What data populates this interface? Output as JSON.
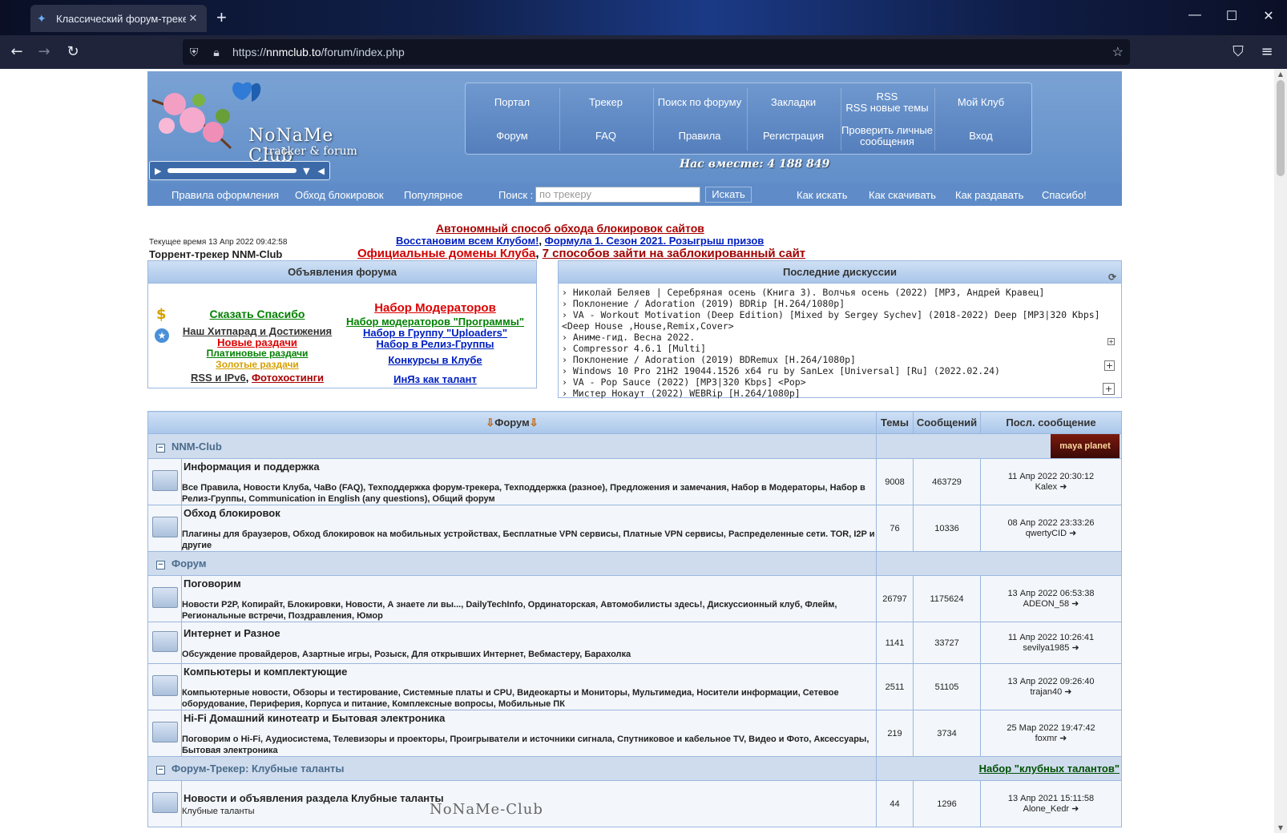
{
  "browser": {
    "tab_title": "Классический форум-трекер",
    "url_host": "nnmclub.to",
    "url_path": "/forum/index.php",
    "url_scheme": "https://"
  },
  "header": {
    "logo_name": "NoNaMe Club",
    "logo_sub": "tracker & forum",
    "menu": [
      [
        "Портал",
        "Трекер",
        "Поиск по форуму",
        "Закладки",
        "RSS\nRSS новые темы",
        "Мой Клуб"
      ],
      [
        "Форум",
        "FAQ",
        "Правила",
        "Регистрация",
        "Проверить личные сообщения",
        "Вход"
      ]
    ],
    "together": "Нас вместе: 4 188 849"
  },
  "subnav": {
    "left": [
      "Правила оформления",
      "Обход блокировок",
      "Популярное"
    ],
    "search_label": "Поиск :",
    "search_placeholder": "по трекеру",
    "search_button": "Искать",
    "right": [
      "Как искать",
      "Как скачивать",
      "Как раздавать",
      "Спасибо!"
    ]
  },
  "info": {
    "time": "Текущее время 13 Апр 2022 09:42:58",
    "tracker_title": "Торрент-трекер NNM-Club",
    "line1": "Автономный способ обхода блокировок сайтов",
    "line2a": "Восстановим всем Клубом!",
    "line2b": "Формула 1. Сезон 2021. Розыгрыш призов",
    "line3a": "Официальные домены Клуба",
    "line3b": "7 способов зайти на заблокированный сайт"
  },
  "announcements": {
    "title": "Объявления форума",
    "left": [
      "Сказать Спасибо",
      "Наш Хитпарад и Достижения",
      "Новые раздачи",
      "Платиновые раздачи",
      "Золотые раздачи",
      "RSS и IPv6",
      "Фотохостинги"
    ],
    "right": [
      "Набор Модераторов",
      "Набор модераторов \"Программы\"",
      "Набор в Группу \"Uploaders\"",
      "Набор в Релиз-Группы",
      "Конкурсы в Клубе",
      "ИнЯз как талант"
    ]
  },
  "discussions": {
    "title": "Последние дискуссии",
    "items": [
      "Николай Беляев | Серебряная осень (Книга 3). Волчья осень (2022) [MP3, Андрей Кравец]",
      "Поклонение / Adoration (2019) BDRip [H.264/1080p]",
      "VA - Workout Motivation (Deep Edition) [Mixed by Sergey Sychev] (2018-2022) Deep [MP3|320 Kbps] <Deep House ,House,Remix,Cover>",
      "Аниме-гид. Весна 2022.",
      "Compressor 4.6.1 [Multi]",
      "Поклонение / Adoration (2019) BDRemux [H.264/1080p]",
      "Windows 10 Pro 21H2 19044.1526 x64 ru by SanLex [Universal] [Ru] (2022.02.24)",
      "VA - Pop Sauce (2022) [MP3|320 Kbps] <Pop>",
      "Мистер Нокаут (2022) WEBRip [H.264/1080p]"
    ]
  },
  "table": {
    "headers": [
      "Форум",
      "Темы",
      "Сообщений",
      "Посл. сообщение"
    ],
    "cat1": "NNM-Club",
    "cat1_badge": "maya planet",
    "cat2": "Форум",
    "cat3": "Форум-Трекер: Клубные таланты",
    "cat3_link": "Набор \"клубных талантов\"",
    "rows": [
      {
        "name": "Информация и поддержка",
        "subs": "Все Правила, Новости Клуба, ЧаВо (FAQ), Техподдержка форум-трекера, Техподдержка (разное), Предложения и замечания, Набор в Модераторы, Набор в Релиз-Группы, Communication in English (any questions), Общий форум",
        "topics": "9008",
        "posts": "463729",
        "date": "11 Апр 2022 20:30:12",
        "user": "Kalex"
      },
      {
        "name": "Обход блокировок",
        "subs": "Плагины для браузеров, Обход блокировок на мобильных устройствах, Бесплатные VPN сервисы, Платные VPN сервисы, Распределенные сети. TOR, I2P и другие",
        "topics": "76",
        "posts": "10336",
        "date": "08 Апр 2022 23:33:26",
        "user": "qwertyCID"
      },
      {
        "name": "Поговорим",
        "subs": "Новости P2P, Копирайт, Блокировки, Новости, А знаете ли вы..., DailyTechInfo, Ординаторская, Автомобилисты здесь!, Дискуссионный клуб, Флейм, Региональные встречи, Поздравления, Юмор",
        "topics": "26797",
        "posts": "1175624",
        "date": "13 Апр 2022 06:53:38",
        "user": "ADEON_58"
      },
      {
        "name": "Интернет и Разное",
        "subs": "Обсуждение провайдеров, Азартные игры, Розыск, Для открывших Интернет, Вебмастеру, Барахолка",
        "topics": "1141",
        "posts": "33727",
        "date": "11 Апр 2022 10:26:41",
        "user": "sevilya1985"
      },
      {
        "name": "Компьютеры и комплектующие",
        "subs": "Компьютерные новости, Обзоры и тестирование, Системные платы и CPU, Видеокарты и Мониторы, Мультимедиа, Носители информации, Сетевое оборудование, Периферия, Корпуса и питание, Комплексные вопросы, Мобильные ПК",
        "topics": "2511",
        "posts": "51105",
        "date": "13 Апр 2022 09:26:40",
        "user": "trajan40"
      },
      {
        "name": "Hi-Fi Домашний кинотеатр и Бытовая электроника",
        "subs": "Поговорим о Hi-Fi, Аудиосистема, Телевизоры и проекторы, Проигрыватели и источники сигнала, Спутниковое и кабельное TV, Видео и Фото, Аксессуары, Бытовая электроника",
        "topics": "219",
        "posts": "3734",
        "date": "25 Мар 2022 19:47:42",
        "user": "foxmr"
      },
      {
        "name": "Новости и объявления раздела Клубные таланты",
        "subs": "Клубные таланты",
        "topics": "44",
        "posts": "1296",
        "date": "13 Апр 2021 15:11:58",
        "user": "Alone_Kedr"
      }
    ]
  },
  "watermark": "NoNaMe-Club"
}
